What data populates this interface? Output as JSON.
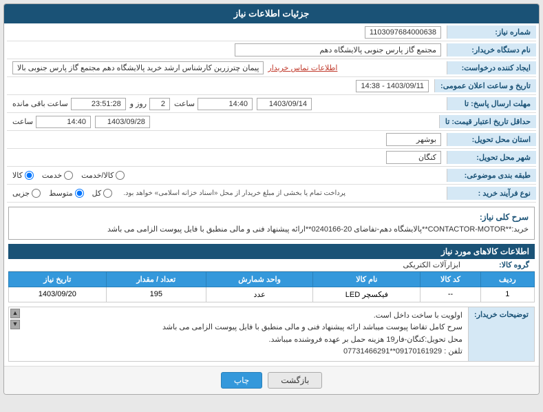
{
  "page": {
    "title": "جزئیات اطلاعات نیاز",
    "header": {
      "bg": "#1a5276",
      "text_color": "#fff"
    }
  },
  "fields": {
    "shomareNiaz_label": "شماره نیاز:",
    "shomareNiaz_value": "1103097684000638",
    "namDastgah_label": "نام دستگاه خریدار:",
    "namDastgah_value": "مجتمع گاز پارس جنوبی  پالایشگاه دهم",
    "ijadKonande_label": "ایجاد کننده درخواست:",
    "ijadKonande_value": "پیمان چترزرین کارشناس ارشد خرید پالایشگاه دهم مجتمع گاز پارس جنوبی  بالا",
    "ijadKonande_link": "اطلاعات تماس خریدار",
    "tarikh_label": "تاریخ و ساعت اعلان عمومی:",
    "tarikh_value": "1403/09/11 - 14:38",
    "mohlatErsal_label": "مهلت ارسال پاسخ: تا",
    "mohlatErsal_date": "1403/09/14",
    "mohlatErsal_saat": "14:40",
    "mohlatErsal_roz": "2",
    "mohlatErsal_baghimande": "23:51:28",
    "hadaqal_label": "حداقل تاریخ اعتبار قیمت: تا",
    "hadaqal_date": "1403/09/28",
    "hadaqal_saat": "14:40",
    "ostan_label": "استان محل تحویل:",
    "ostan_value": "بوشهر",
    "shahr_label": "شهر محل تحویل:",
    "shahr_value": "کنگان",
    "tabaghe_label": "طبقه بندی موضوعی:",
    "tabaghe_options": [
      "کالا",
      "خدمت",
      "کالا/خدمت"
    ],
    "tabaghe_selected": "کالا",
    "naveFarayand_label": "نوع فرآیند خرید :",
    "naveFarayand_options": [
      "جزیی",
      "متوسط",
      "کل"
    ],
    "naveFarayand_selected": "متوسط",
    "naveFarayand_note": "پرداخت تمام یا بخشی از مبلغ خریدار از محل «اسناد خزانه اسلامی» خواهد بود.",
    "srh_label": "سرح کلی نیاز:",
    "srh_value": "خرید:**CONTACTOR-MOTOR**پالایشگاه دهم-تفاضای 20-0240166**ارائه پیشنهاد فنی و مالی منطبق با فایل پیوست الزامی می باشد",
    "kalaInfo_header": "اطلاعات کالاهای مورد نیاز",
    "groheKala_label": "گروه کالا:",
    "groheKala_value": "ابزارآلات الکتریکی",
    "table_headers": [
      "ردیف",
      "کد کالا",
      "نام کالا",
      "واحد شمارش",
      "تعداد / مقدار",
      "تاریخ نیاز"
    ],
    "table_rows": [
      {
        "radif": "1",
        "kodKala": "--",
        "namKala": "فیکسچر LED",
        "vahed": "عدد",
        "tedad": "195",
        "tarikh": "1403/09/20"
      }
    ],
    "notes_label": "توضیحات خریدار:",
    "notes_lines": [
      "اولویت با ساخت داخل است.",
      "سرح کامل تقاضا پیوست میباشد ارائه پیشنهاد فنی و مالی منطبق با فایل پیوست الزامی می باشد",
      "محل تحویل:کنگان-فار19 هزینه حمل بر عهده فروشنده میباشد.",
      "تلفن : 09170161929**07731466291"
    ],
    "btn_chap": "چاپ",
    "btn_bazgasht": "بازگشت"
  }
}
